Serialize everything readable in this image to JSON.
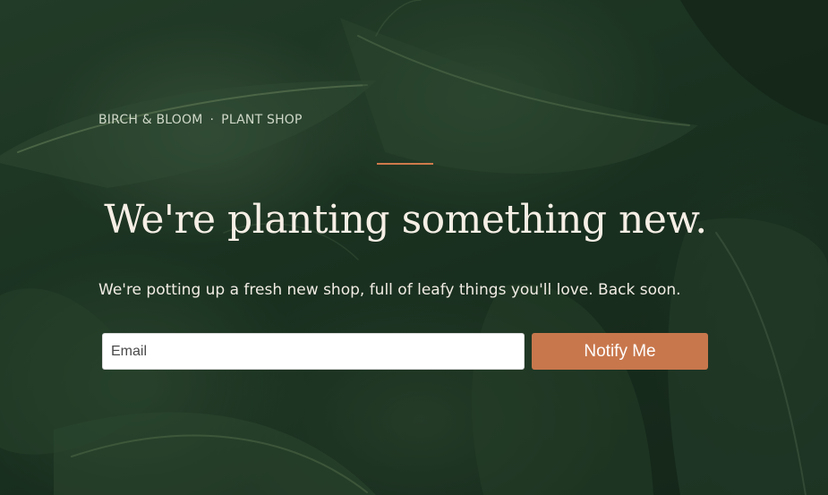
{
  "brand": {
    "name": "BIRCH & BLOOM",
    "separator": "·",
    "tagline": "PLANT SHOP"
  },
  "hero": {
    "headline": "We're planting something new.",
    "subtext": "We're potting up a fresh new shop, full of leafy things you'll love. Back soon."
  },
  "signup": {
    "email_placeholder": "Email",
    "email_value": "",
    "button_label": "Notify Me"
  },
  "colors": {
    "accent": "#cf7a4c",
    "button": "#c8774c",
    "background": "#1f3826",
    "headline": "#f6efe6"
  }
}
